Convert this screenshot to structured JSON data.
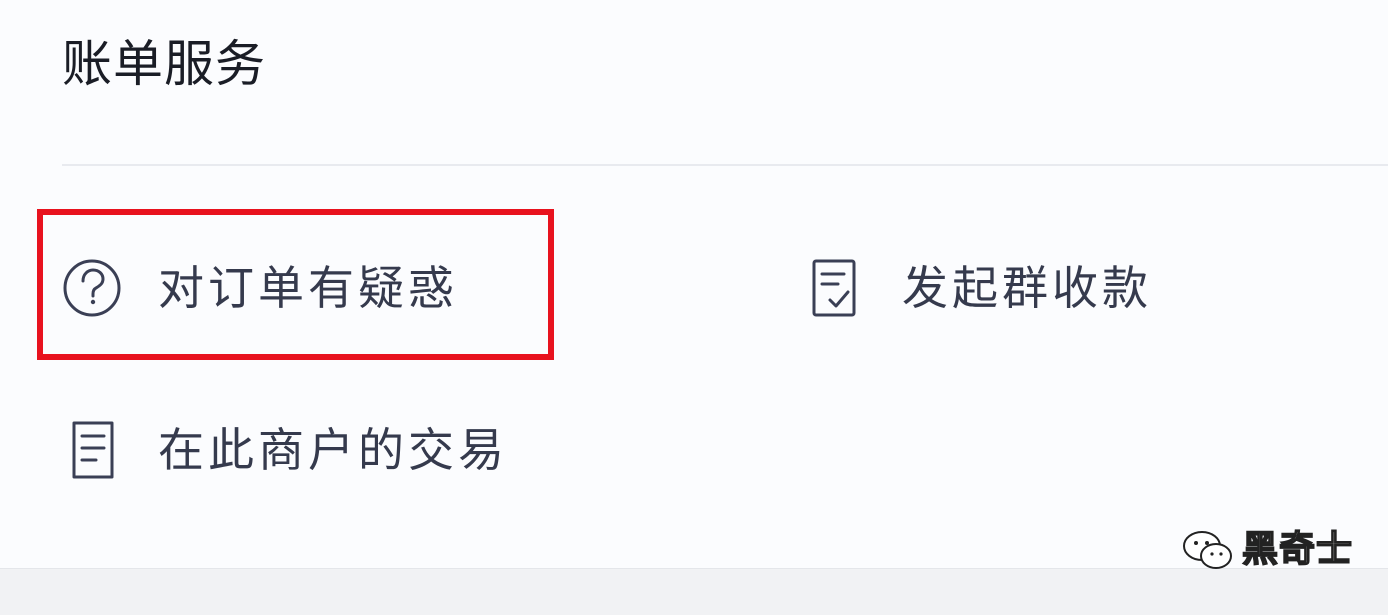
{
  "section": {
    "title": "账单服务"
  },
  "items": [
    {
      "label": "对订单有疑惑",
      "icon": "question-circle-icon"
    },
    {
      "label": "发起群收款",
      "icon": "document-check-icon"
    },
    {
      "label": "在此商户的交易",
      "icon": "document-list-icon"
    }
  ],
  "highlight": {
    "color": "#e8121e"
  },
  "watermark": {
    "text": "黑奇士",
    "icon": "wechat-logo-icon"
  },
  "colors": {
    "icon_stroke": "#3a3f55",
    "text": "#353a4d",
    "title": "#1a1d26",
    "background": "#fbfcfe"
  }
}
